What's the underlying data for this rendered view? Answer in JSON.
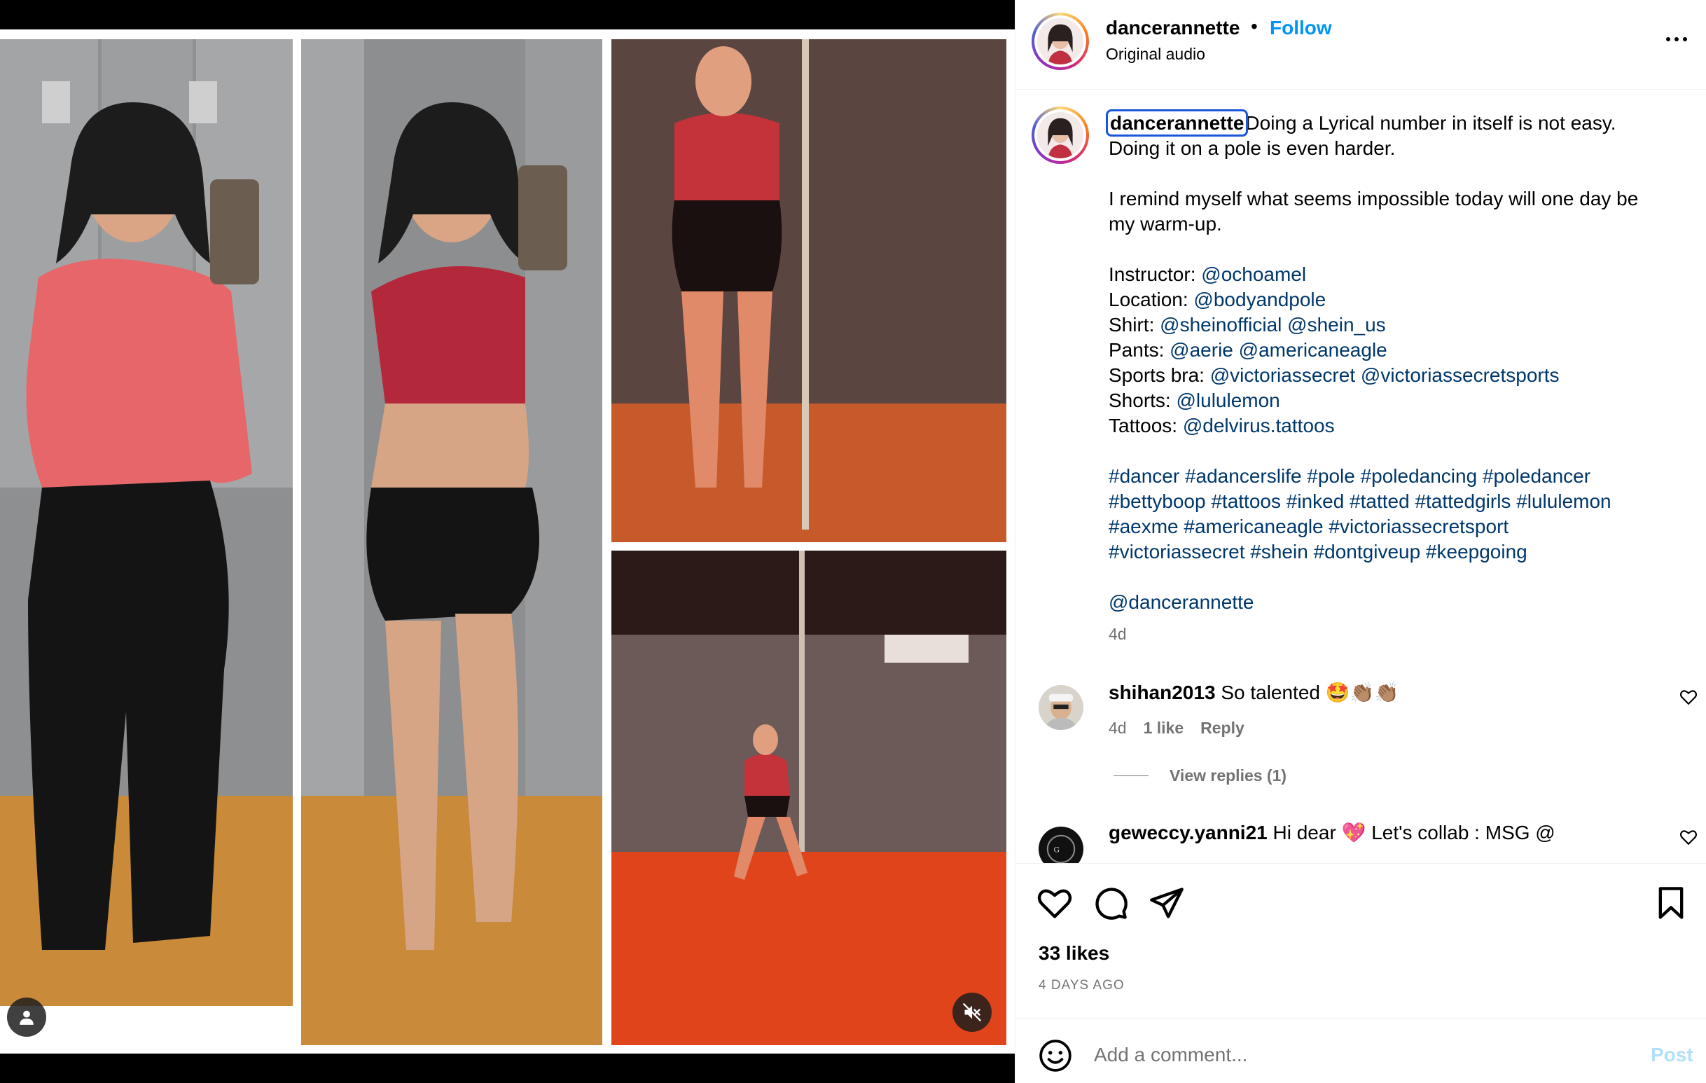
{
  "header": {
    "username": "dancerannette",
    "separator": "•",
    "follow_label": "Follow",
    "audio": "Original audio",
    "more_icon": "more-horizontal-icon"
  },
  "caption": {
    "username": "dancerannette",
    "intro": "Doing a Lyrical number in itself is not easy. Doing it on a pole is even harder.",
    "reflection": "I remind myself what seems impossible today will one day be my warm-up.",
    "credits": [
      {
        "label": "Instructor:",
        "mentions": [
          "@ochoamel"
        ]
      },
      {
        "label": "Location:",
        "mentions": [
          "@bodyandpole"
        ]
      },
      {
        "label": "Shirt:",
        "mentions": [
          "@sheinofficial",
          "@shein_us"
        ]
      },
      {
        "label": "Pants:",
        "mentions": [
          "@aerie",
          "@americaneagle"
        ]
      },
      {
        "label": "Sports bra:",
        "mentions": [
          "@victoriassecret",
          "@victoriassecretsports"
        ]
      },
      {
        "label": "Shorts:",
        "mentions": [
          "@lululemon"
        ]
      },
      {
        "label": "Tattoos:",
        "mentions": [
          "@delvirus.tattoos"
        ]
      }
    ],
    "hashtag_lines": [
      "#dancer #adancerslife #pole #poledancing #poledancer",
      "#bettyboop #tattoos #inked #tatted #tattedgirls #lululemon",
      "#aexme #americaneagle #victoriassecretsport",
      "#victoriassecret #shein #dontgiveup #keepgoing"
    ],
    "self_mention": "@dancerannette",
    "time": "4d"
  },
  "comments": [
    {
      "username": "shihan2013",
      "text": "So talented 🤩👏🏽👏🏽",
      "time": "4d",
      "likes": "1 like",
      "reply_label": "Reply",
      "view_replies": "View replies (1)"
    },
    {
      "username": "geweccy.yanni21",
      "text": "Hi dear 💖 Let's collab : MSG @"
    }
  ],
  "actions": {
    "icons": [
      "heart-icon",
      "comment-icon",
      "share-icon",
      "bookmark-icon"
    ],
    "likes": "33 likes",
    "date": "4 DAYS AGO"
  },
  "add_comment": {
    "placeholder": "Add a comment...",
    "post_label": "Post",
    "emoji_icon": "emoji-icon"
  },
  "media": {
    "user_tag_icon": "user-icon",
    "mute_icon": "speaker-muted-icon"
  },
  "colors": {
    "follow": "#0095f6",
    "link": "#00376b",
    "secondary": "#737373",
    "post_disabled": "#b2dffc",
    "focus_outline": "#1a56db"
  }
}
